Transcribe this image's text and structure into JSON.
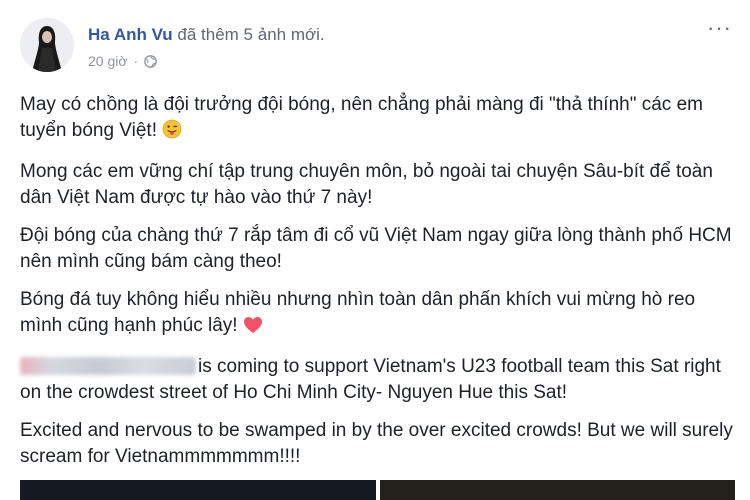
{
  "post": {
    "author": "Ha Anh Vu",
    "action": " đã thêm 5 ảnh mới.",
    "time": "20 giờ",
    "separator": "·",
    "more_label": "···",
    "paragraphs": [
      "May có chồng là đội trưởng đội bóng, nên chẳng phải màng đi \"thả thính\" các em tuyển bóng Việt! ",
      "Mong các em vững chí tập trung chuyên môn, bỏ ngoài tai chuyện Sâu-bít để toàn dân Việt Nam được tự hào vào thứ 7 này!",
      "Đội bóng của chàng thứ 7 rắp tâm đi cổ vũ Việt Nam ngay giữa lòng thành phố HCM nên mình cũng bám càng theo!",
      "Bóng đá tuy không hiểu nhiều nhưng nhìn toàn dân phấn khích vui mừng hò reo mình cũng hạnh phúc lây! "
    ],
    "english_paragraph": "is coming to support Vietnam's U23 football team this Sat right on the crowdest street of Ho Chi Minh City- Nguyen Hue this Sat!",
    "closing_paragraph": "Excited and nervous to be swamped in by the over excited crowds! But we will surely scream for Vietnammmmmmm!!!!",
    "icons": {
      "globe": "globe-icon",
      "tongue_emoji": "tongue-out-emoji-icon",
      "heart": "heart-icon",
      "more": "more-options-icon"
    },
    "colors": {
      "author": "#365899",
      "heart": "#f25268",
      "meta": "#90949c"
    }
  }
}
